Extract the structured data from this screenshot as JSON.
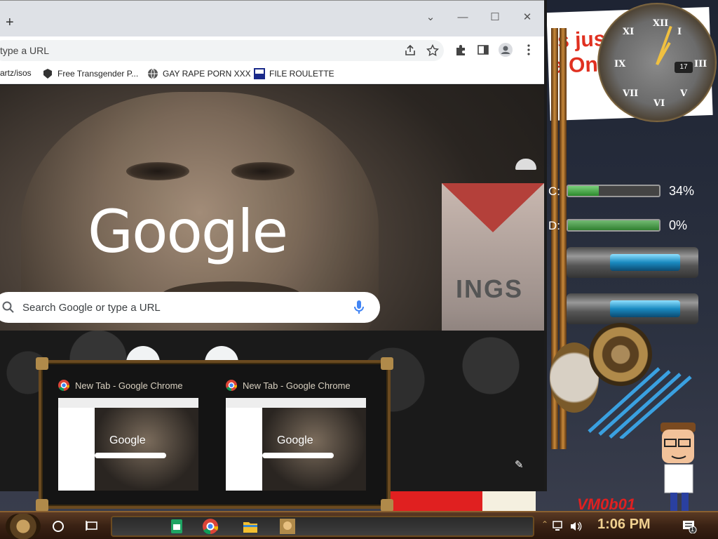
{
  "browser": {
    "new_tab_symbol": "+",
    "omnibox_text": "type a URL",
    "bookmarks": [
      {
        "label": "artz/isos"
      },
      {
        "label": "Free Transgender P..."
      },
      {
        "label": "GAY RAPE PORN XXX"
      },
      {
        "label": "FILE ROULETTE"
      }
    ],
    "window_controls": {
      "minimize": "—",
      "maximize": "☐",
      "close": "✕",
      "dropdown": "⌄"
    }
  },
  "new_tab_page": {
    "logo": "Google",
    "search_placeholder": "Search Google or type a URL",
    "background_sign_text": "INGS"
  },
  "desktop_widgets": {
    "banner_line1": "is just",
    "banner_line2": "e One",
    "clock_sub": "17",
    "meters": [
      {
        "label": "C:",
        "percent": 34,
        "percent_text": "34%"
      },
      {
        "label": "D:",
        "percent": 0,
        "percent_text": "0%"
      }
    ],
    "wallpaper_signature": "VM0b01"
  },
  "thumbnails": [
    {
      "title": "New Tab - Google Chrome",
      "preview_logo": "Google"
    },
    {
      "title": "New Tab - Google Chrome",
      "preview_logo": "Google"
    }
  ],
  "taskbar": {
    "time": "1:06 PM",
    "notification_count": "1",
    "apps": [
      "sheets-icon",
      "chrome-icon",
      "file-explorer-icon",
      "game-icon"
    ]
  },
  "colors": {
    "accent_brass": "#b08a4a",
    "banner_red": "#e03020",
    "google_mic_blue": "#4285f4"
  }
}
